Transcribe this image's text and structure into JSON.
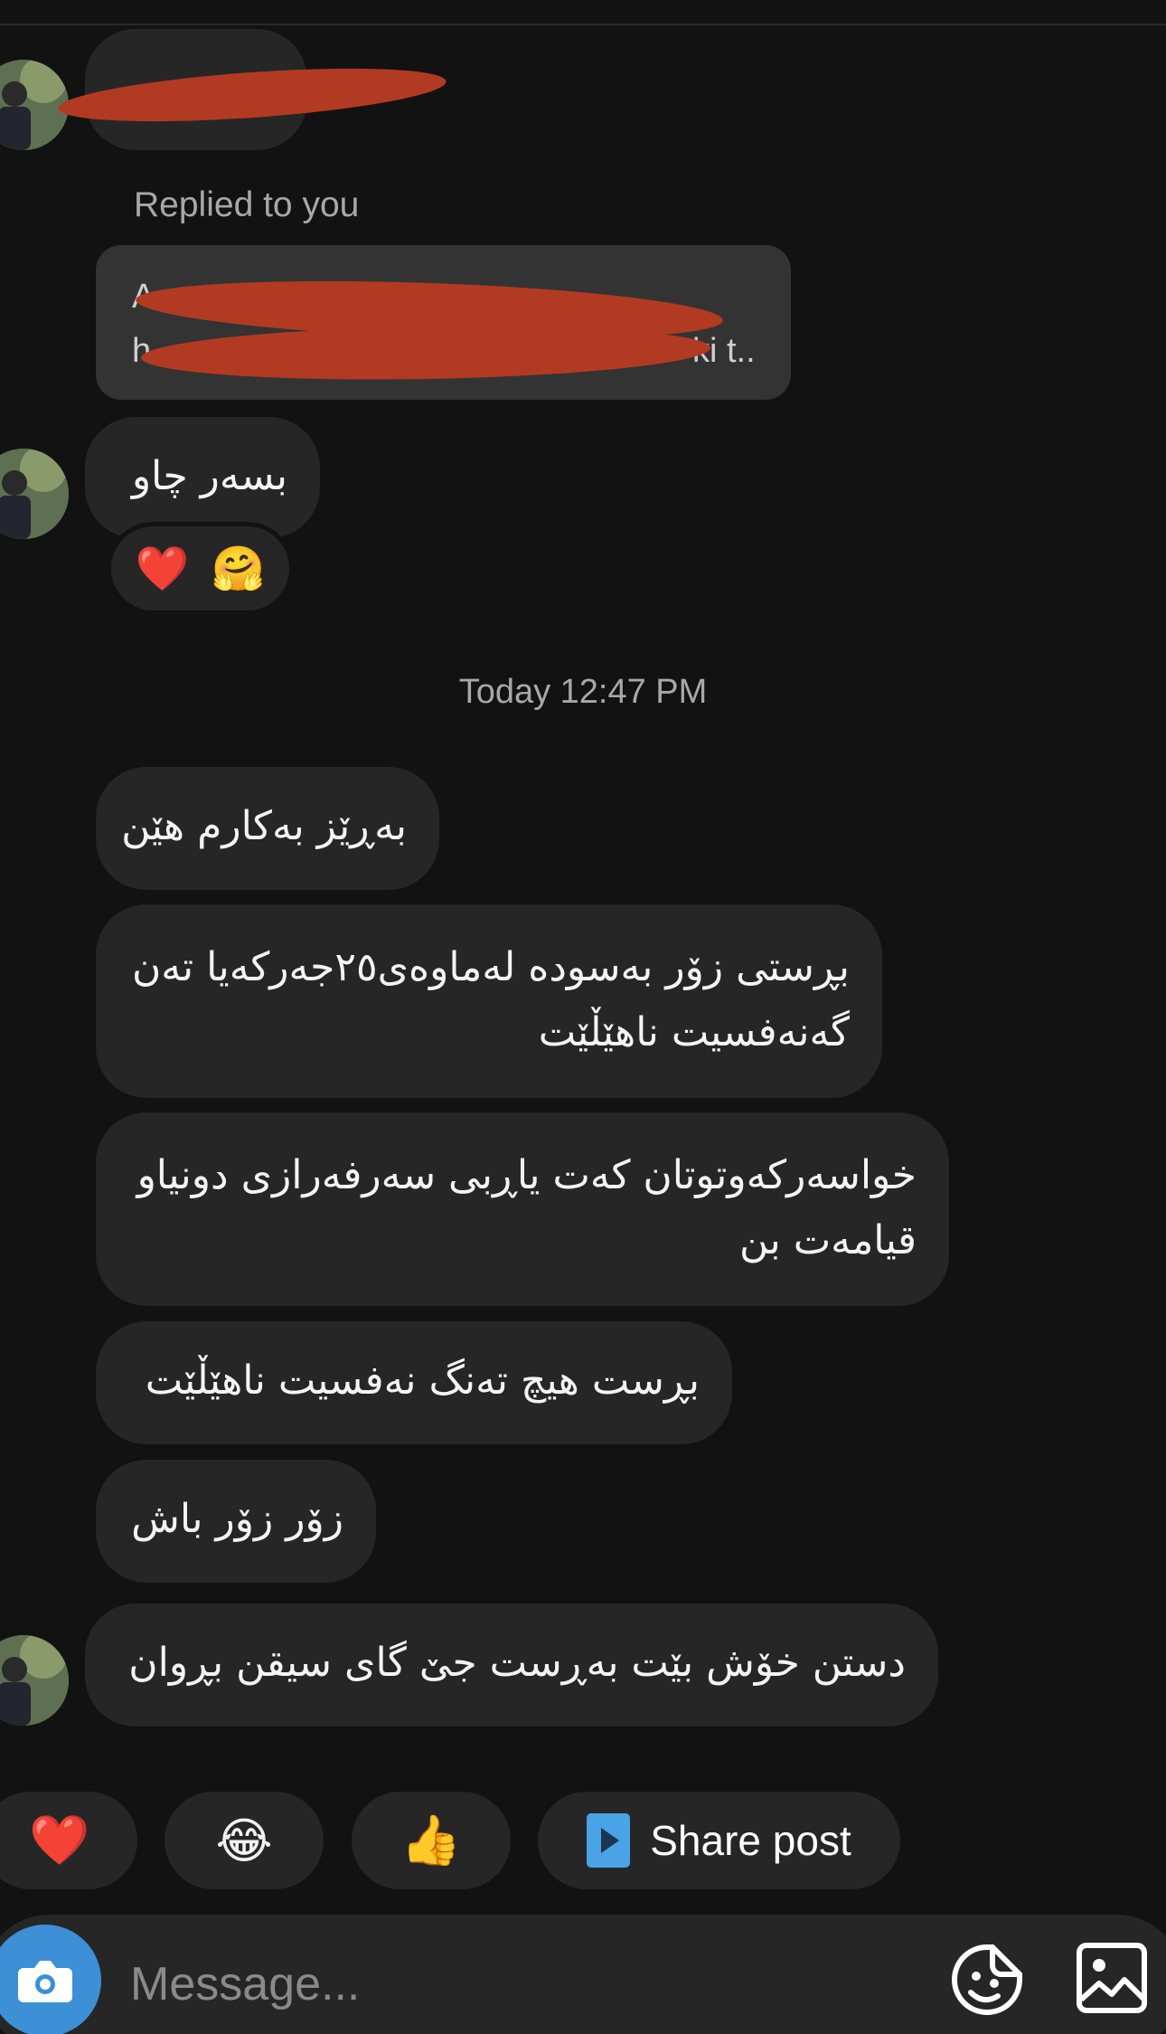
{
  "thread": {
    "first_message": {
      "redacted": true
    },
    "reply_caption": "Replied to you",
    "reply_preview": {
      "line1_visible": "A",
      "line2_start": "h",
      "line2_end": "ki t.."
    },
    "reply_message": {
      "text": "بسەر چاو"
    },
    "reactions": [
      "❤️",
      "🤗"
    ],
    "timestamp": "Today 12:47 PM",
    "messages": [
      {
        "lines": [
          "بەڕێز بەکارم هێن"
        ]
      },
      {
        "lines": [
          "بڕستی زۆر بەسودە  لەماوەی٢٥جەرکەیا تەن",
          "گەنەفسیت ناهێڵێت"
        ]
      },
      {
        "lines": [
          "خواسەرکەوتوتان کەت یاڕبی سەرفەرازی دونیاو",
          "قیامەت بن"
        ]
      },
      {
        "lines": [
          "بڕست هیچ  تەنگ نەفسیت ناهێڵێت"
        ]
      },
      {
        "lines": [
          "زۆر زۆر باش"
        ]
      },
      {
        "lines": [
          "دستن خۆش بێت بەڕست جێ گای سیقن بڕوان"
        ]
      }
    ]
  },
  "quick_replies": {
    "heart": "❤️",
    "laugh": "😂",
    "thumbs": "👍",
    "share_label": "Share post"
  },
  "composer": {
    "placeholder": "Message..."
  },
  "icons": {
    "camera": "camera-icon",
    "sticker": "sticker-icon",
    "gallery": "gallery-icon",
    "share": "share-post-icon"
  },
  "colors": {
    "background": "#121212",
    "bubble": "#262626",
    "accent": "#3d8fd6",
    "redaction": "#b23a22"
  }
}
